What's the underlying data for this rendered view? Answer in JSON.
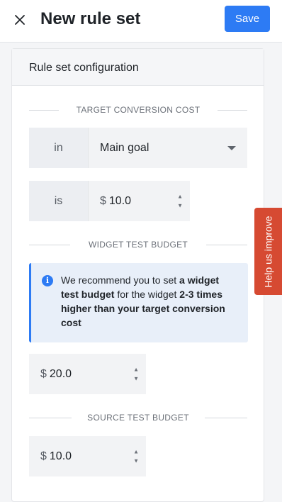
{
  "header": {
    "title": "New rule set",
    "save_label": "Save",
    "close_glyph": "×"
  },
  "card": {
    "title": "Rule set configuration"
  },
  "target_conversion_cost": {
    "heading": "TARGET CONVERSION COST",
    "goal_label": "in",
    "goal_value": "Main goal",
    "cost_label": "is",
    "currency": "$",
    "cost_value": "10.0"
  },
  "widget_test_budget": {
    "heading": "WIDGET TEST BUDGET",
    "info_icon": "info-icon",
    "info_parts": {
      "p1": "We recommend you to set ",
      "b1": "a widget test budget",
      "p2": " for the widget ",
      "b2": "2-3 times higher than your target conversion cost"
    },
    "currency": "$",
    "budget_value": "20.0"
  },
  "source_test_budget": {
    "heading": "SOURCE TEST BUDGET",
    "currency": "$",
    "budget_value": "10.0"
  },
  "help_tab": {
    "label": "Help us improve"
  },
  "colors": {
    "primary": "#2d7bf4",
    "help_tab": "#d64a32",
    "info_bg": "#e8eff9"
  }
}
